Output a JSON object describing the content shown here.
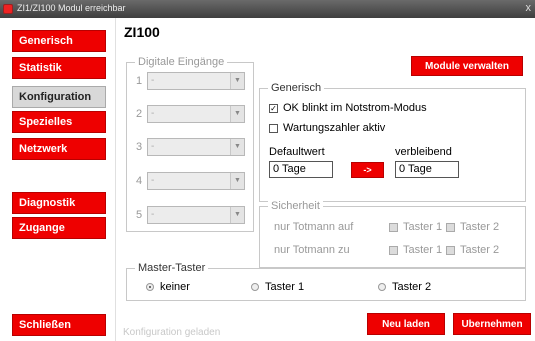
{
  "window": {
    "title": "ZI1/ZI100 Modul erreichbar",
    "close_glyph": "x"
  },
  "sidebar": {
    "items": [
      {
        "label": "Generisch",
        "active": false
      },
      {
        "label": "Statistik",
        "active": false
      },
      {
        "label": "Konfiguration",
        "active": true
      },
      {
        "label": "Spezielles",
        "active": false
      },
      {
        "label": "Netzwerk",
        "active": false
      },
      {
        "label": "Diagnostik",
        "active": false
      },
      {
        "label": "Zugange",
        "active": false
      }
    ],
    "close_label": "Schließen"
  },
  "main": {
    "title": "ZI100",
    "digital_inputs": {
      "legend": "Digitale Eingänge",
      "rows": [
        {
          "num": "1",
          "value": "-"
        },
        {
          "num": "2",
          "value": "-"
        },
        {
          "num": "3",
          "value": "-"
        },
        {
          "num": "4",
          "value": "-"
        },
        {
          "num": "5",
          "value": "-"
        }
      ]
    },
    "manage_modules_label": "Module verwalten",
    "generic": {
      "legend": "Generisch",
      "ok_blink_label": "OK blinkt im Notstrom-Modus",
      "ok_blink_checked": true,
      "maintenance_label": "Wartungszahler aktiv",
      "maintenance_checked": false,
      "default_label": "Defaultwert",
      "default_value": "0 Tage",
      "arrow_label": "->",
      "remaining_label": "verbleibend",
      "remaining_value": "0 Tage"
    },
    "security": {
      "legend": "Sicherheit",
      "rows": [
        {
          "label": "nur Totmann auf",
          "t1": "Taster 1",
          "t2": "Taster 2"
        },
        {
          "label": "nur Totmann zu",
          "t1": "Taster 1",
          "t2": "Taster 2"
        }
      ]
    },
    "master": {
      "legend": "Master-Taster",
      "options": [
        "keiner",
        "Taster 1",
        "Taster 2"
      ],
      "selected": "keiner"
    },
    "status_text": "Konfiguration geladen",
    "reload_label": "Neu laden",
    "apply_label": "Ubernehmen"
  },
  "colors": {
    "accent": "#ee0000",
    "titlebar": "#4a4a4a",
    "active_item": "#d8d8d8"
  }
}
